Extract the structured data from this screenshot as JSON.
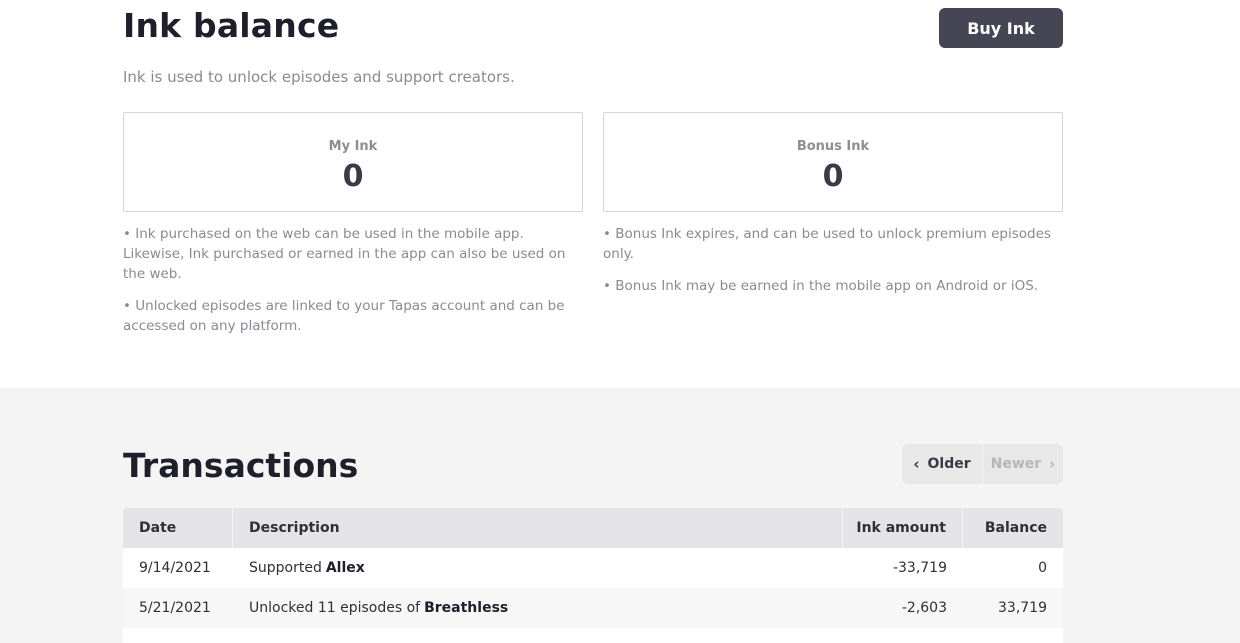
{
  "header": {
    "title": "Ink balance",
    "buy_label": "Buy Ink",
    "subtitle": "Ink is used to unlock episodes and support creators."
  },
  "cards": {
    "my_ink": {
      "label": "My Ink",
      "value": "0"
    },
    "bonus_ink": {
      "label": "Bonus Ink",
      "value": "0"
    }
  },
  "notes": {
    "left": [
      "• Ink purchased on the web can be used in the mobile app. Likewise, Ink purchased or earned in the app can also be used on the web.",
      "• Unlocked episodes are linked to your Tapas account and can be accessed on any platform."
    ],
    "right": [
      "• Bonus Ink expires, and can be used to unlock premium episodes only.",
      "• Bonus Ink may be earned in the mobile app on Android or iOS."
    ]
  },
  "transactions": {
    "title": "Transactions",
    "pager": {
      "older": "Older",
      "newer": "Newer"
    },
    "columns": {
      "date": "Date",
      "description": "Description",
      "amount": "Ink amount",
      "balance": "Balance"
    },
    "rows": [
      {
        "date": "9/14/2021",
        "prefix": "Supported",
        "name": "Allex",
        "amount": "-33,719",
        "balance": "0"
      },
      {
        "date": "5/21/2021",
        "prefix": "Unlocked 11 episodes of",
        "name": "Breathless",
        "amount": "-2,603",
        "balance": "33,719"
      }
    ]
  },
  "icons": {
    "older": "chevron-left-icon",
    "newer": "chevron-right-icon"
  },
  "colors": {
    "button_bg": "#454554",
    "section_bg": "#f4f4f4",
    "header_row_bg": "#e4e4e6"
  }
}
